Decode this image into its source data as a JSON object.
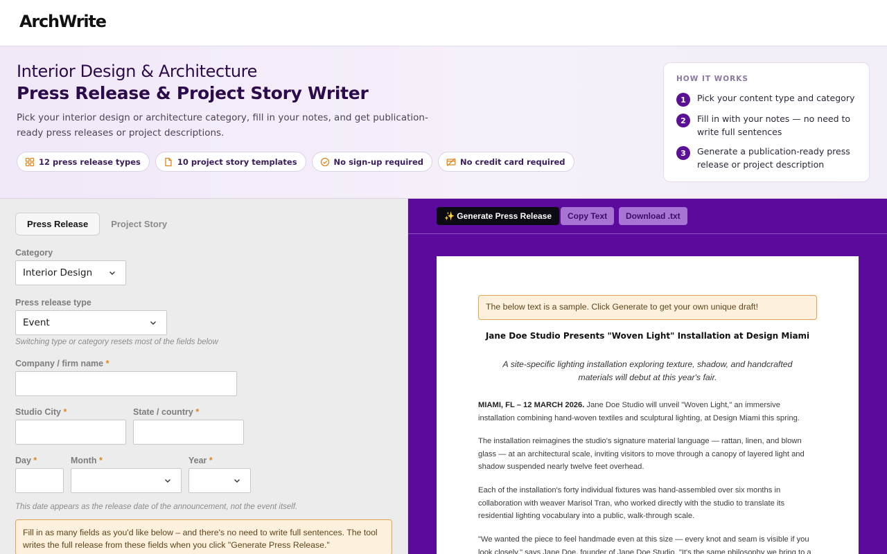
{
  "header": {
    "logo": "ArchWrite"
  },
  "hero": {
    "title_line1": "Interior Design & Architecture",
    "title_line2": "Press Release & Project Story Writer",
    "subtitle": "Pick your interior design or architecture category, fill in your notes, and get publication-ready press releases or project descriptions.",
    "chips": [
      {
        "icon": "grid-icon",
        "label": "12 press release types"
      },
      {
        "icon": "document-icon",
        "label": "10 project story templates"
      },
      {
        "icon": "check-circle-icon",
        "label": "No sign-up required"
      },
      {
        "icon": "credit-card-off-icon",
        "label": "No credit card required"
      }
    ],
    "accent_color": "#e0851b"
  },
  "how_it_works": {
    "title": "HOW IT WORKS",
    "steps": [
      {
        "num": "1",
        "text": "Pick your content type and category"
      },
      {
        "num": "2",
        "text": "Fill in with your notes — no need to write full sentences"
      },
      {
        "num": "3",
        "text": "Generate a publication-ready press release or project description"
      }
    ]
  },
  "form": {
    "tabs": [
      {
        "label": "Press Release",
        "active": true
      },
      {
        "label": "Project Story",
        "active": false
      }
    ],
    "category_label": "Category",
    "category_value": "Interior Design",
    "type_label": "Press release type",
    "type_value": "Event",
    "type_hint": "Switching type or category resets most of the fields below",
    "company_label": "Company / firm name",
    "company_value": "",
    "city_label": "Studio City",
    "city_value": "",
    "state_label": "State / country",
    "state_value": "",
    "day_label": "Day",
    "day_value": "",
    "month_label": "Month",
    "month_value": "",
    "year_label": "Year",
    "year_value": "",
    "required_mark": "*",
    "date_hint": "This date appears as the release date of the announcement, not the event itself.",
    "notice": "Fill in as many fields as you'd like below – and there's no need to write full sentences. The tool writes the full release from these fields when you click \"Generate Press Release.\""
  },
  "preview": {
    "generate_label": "✨ Generate Press Release",
    "copy_label": "Copy Text",
    "download_label": "Download .txt",
    "panel_color": "#5b0a9b",
    "sample_notice": "The below text is a sample. Click Generate to get your own unique draft!",
    "headline": "Jane Doe Studio Presents \"Woven Light\" Installation at Design Miami",
    "subheadline": "A site-specific lighting installation exploring texture, shadow, and handcrafted materials will debut at this year's fair.",
    "dateline": "MIAMI, FL – 12 MARCH 2026.",
    "p1": "Jane Doe Studio will unveil \"Woven Light,\" an immersive installation combining hand-woven textiles and sculptural lighting, at Design Miami this spring.",
    "p2": "The installation reimagines the studio's signature material language — rattan, linen, and blown glass — at an architectural scale, inviting visitors to move through a canopy of layered light and shadow suspended nearly twelve feet overhead.",
    "p3": "Each of the installation's forty individual fixtures was hand-assembled over six months in collaboration with weaver Marisol Tran, who worked directly with the studio to translate its residential lighting vocabulary into a public, walk-through scale.",
    "p4": "\"We wanted the piece to feel handmade even at this size — every knot and seam is visible if you look closely,\" says Jane Doe, founder of Jane Doe Studio. \"It's the same philosophy we bring to a"
  }
}
